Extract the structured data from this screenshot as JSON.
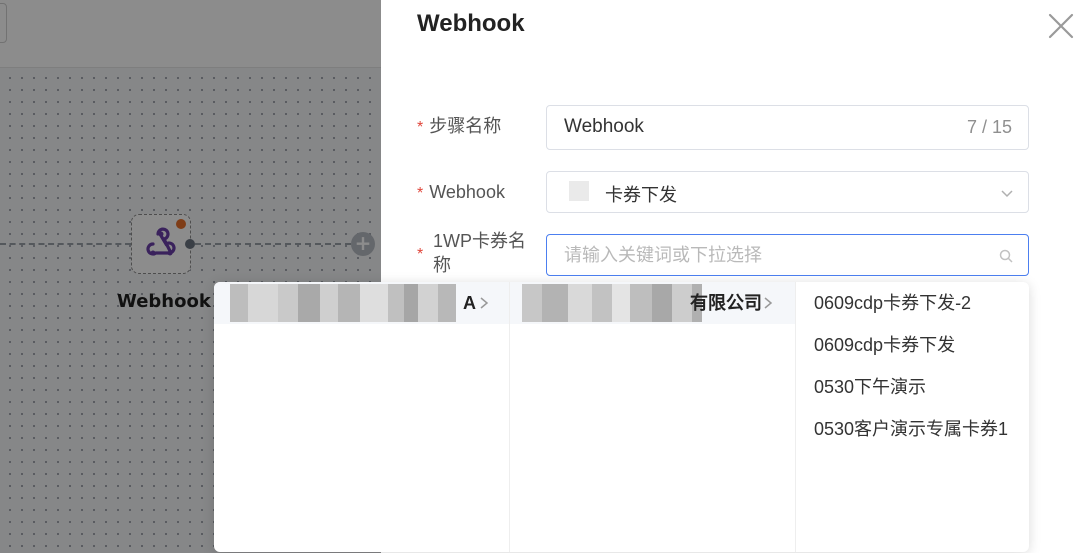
{
  "canvas": {
    "node_label": "Webhook",
    "add_symbol": "+"
  },
  "drawer": {
    "title": "Webhook",
    "close_icon": "close-icon",
    "required_mark": "*",
    "fields": {
      "step_name": {
        "label": "步骤名称",
        "value": "Webhook",
        "counter": "7 / 15"
      },
      "webhook": {
        "label": "Webhook",
        "value": "卡券下发"
      },
      "coupon": {
        "label": "1WP卡券名称",
        "placeholder": "请输入关键词或下拉选择"
      }
    }
  },
  "cascader": {
    "column1": [
      {
        "label_suffix": "A",
        "redacted": true
      }
    ],
    "column2": [
      {
        "label_suffix": "有限公司",
        "redacted": true
      }
    ],
    "column3": [
      {
        "label": "0609cdp卡券下发-2"
      },
      {
        "label": "0609cdp卡券下发"
      },
      {
        "label": "0530下午演示"
      },
      {
        "label": "0530客户演示专属卡券1"
      }
    ]
  },
  "colors": {
    "accent": "#4c7ff0",
    "required": "#e0453a",
    "node_icon": "#6a3ea8",
    "node_badge": "#e8702a"
  }
}
